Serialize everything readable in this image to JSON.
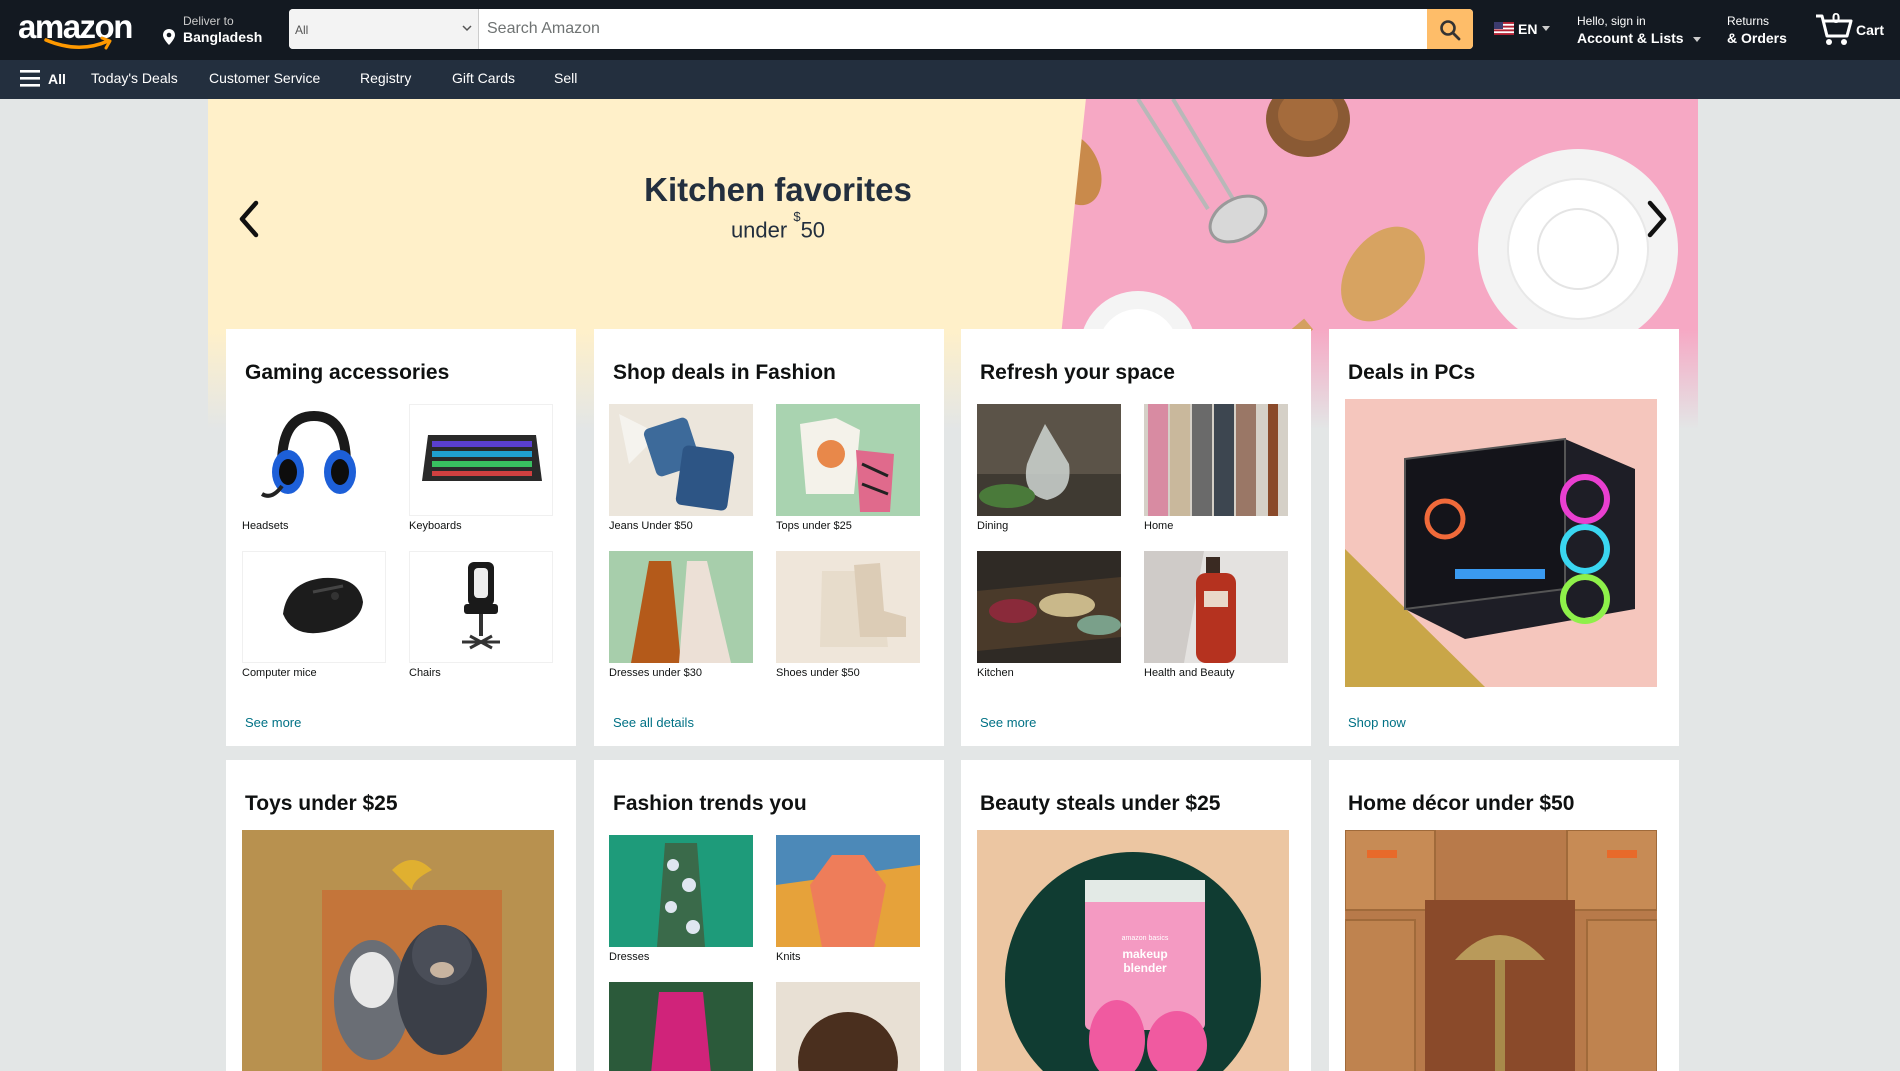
{
  "header": {
    "logo_text": "amazon",
    "deliver_line1": "Deliver to",
    "deliver_line2": "Bangladesh",
    "search_category": "All",
    "search_placeholder": "Search Amazon",
    "language": "EN",
    "account_line1": "Hello, sign in",
    "account_line2": "Account & Lists",
    "returns_line1": "Returns",
    "returns_line2": "& Orders",
    "cart_count": "0",
    "cart_label": "Cart"
  },
  "subnav": {
    "all_label": "All",
    "items": [
      "Today's Deals",
      "Customer Service",
      "Registry",
      "Gift Cards",
      "Sell"
    ]
  },
  "hero": {
    "title": "Kitchen favorites",
    "subtitle_prefix": "under ",
    "subtitle_currency": "$",
    "subtitle_amount": "50"
  },
  "cards": [
    {
      "title": "Gaming accessories",
      "tiles": [
        "Headsets",
        "Keyboards",
        "Computer mice",
        "Chairs"
      ],
      "link": "See more"
    },
    {
      "title": "Shop deals in Fashion",
      "tiles": [
        "Jeans Under $50",
        "Tops under $25",
        "Dresses under $30",
        "Shoes under $50"
      ],
      "link": "See all details"
    },
    {
      "title": "Refresh your space",
      "tiles": [
        "Dining",
        "Home",
        "Kitchen",
        "Health and Beauty"
      ],
      "link": "See more"
    },
    {
      "title": "Deals in PCs",
      "link": "Shop now"
    },
    {
      "title": "Toys under $25"
    },
    {
      "title": "Fashion trends you",
      "tiles": [
        "Dresses",
        "Knits"
      ]
    },
    {
      "title": "Beauty steals under $25",
      "product_text_1": "amazon basics",
      "product_text_2": "makeup",
      "product_text_3": "blender"
    },
    {
      "title": "Home décor under $50"
    }
  ],
  "colors": {
    "nav_dark": "#131921",
    "nav_sub": "#232f3e",
    "search_button": "#febd69",
    "link": "#007185",
    "page_bg": "#e3e6e6",
    "hero_yellow": "#fff0c9",
    "hero_pink": "#f6a8c4"
  }
}
